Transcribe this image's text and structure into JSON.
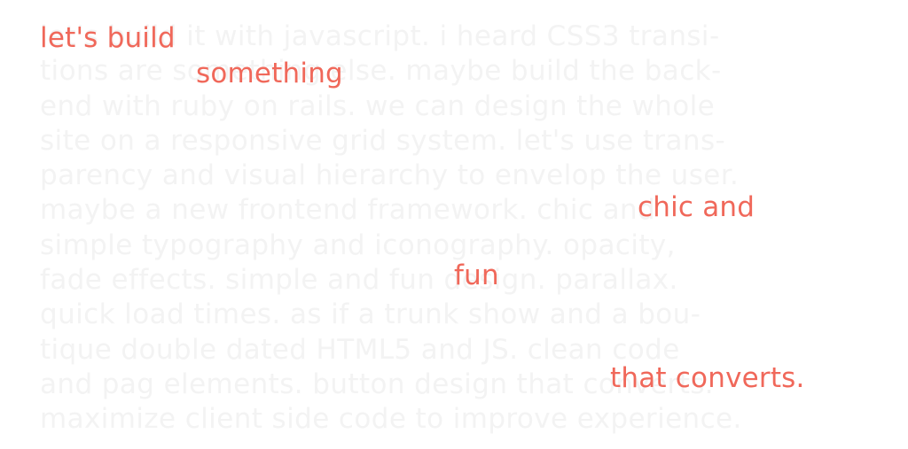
{
  "background_text": {
    "lines": [
      "let's build it with javascript. i heard CSS3 transi-",
      "tions are something else. maybe build the back-",
      "end with ruby on rails. we can design the whole",
      "site on a responsive grid system. let's use trans-",
      "parency and visual hierarchy to envelop the user.",
      "maybe a new frontend framework. chic and",
      "simple typography and iconography. opacity,",
      "fade effects. simple and fun design. parallax.",
      "quick load times. as if a trunk show and a bou-",
      "tique double dated HTML5 and JS. clean code",
      "and pag elements. button design that converts.",
      "maximize client side code to improve experience."
    ]
  },
  "highlights": {
    "h1": "let's build",
    "h2": "something",
    "h3": "chic and",
    "h4": "fun",
    "h5": "that converts."
  },
  "colors": {
    "accent": "#f0685a",
    "faded_text": "#f3f3f3",
    "background": "#ffffff"
  }
}
